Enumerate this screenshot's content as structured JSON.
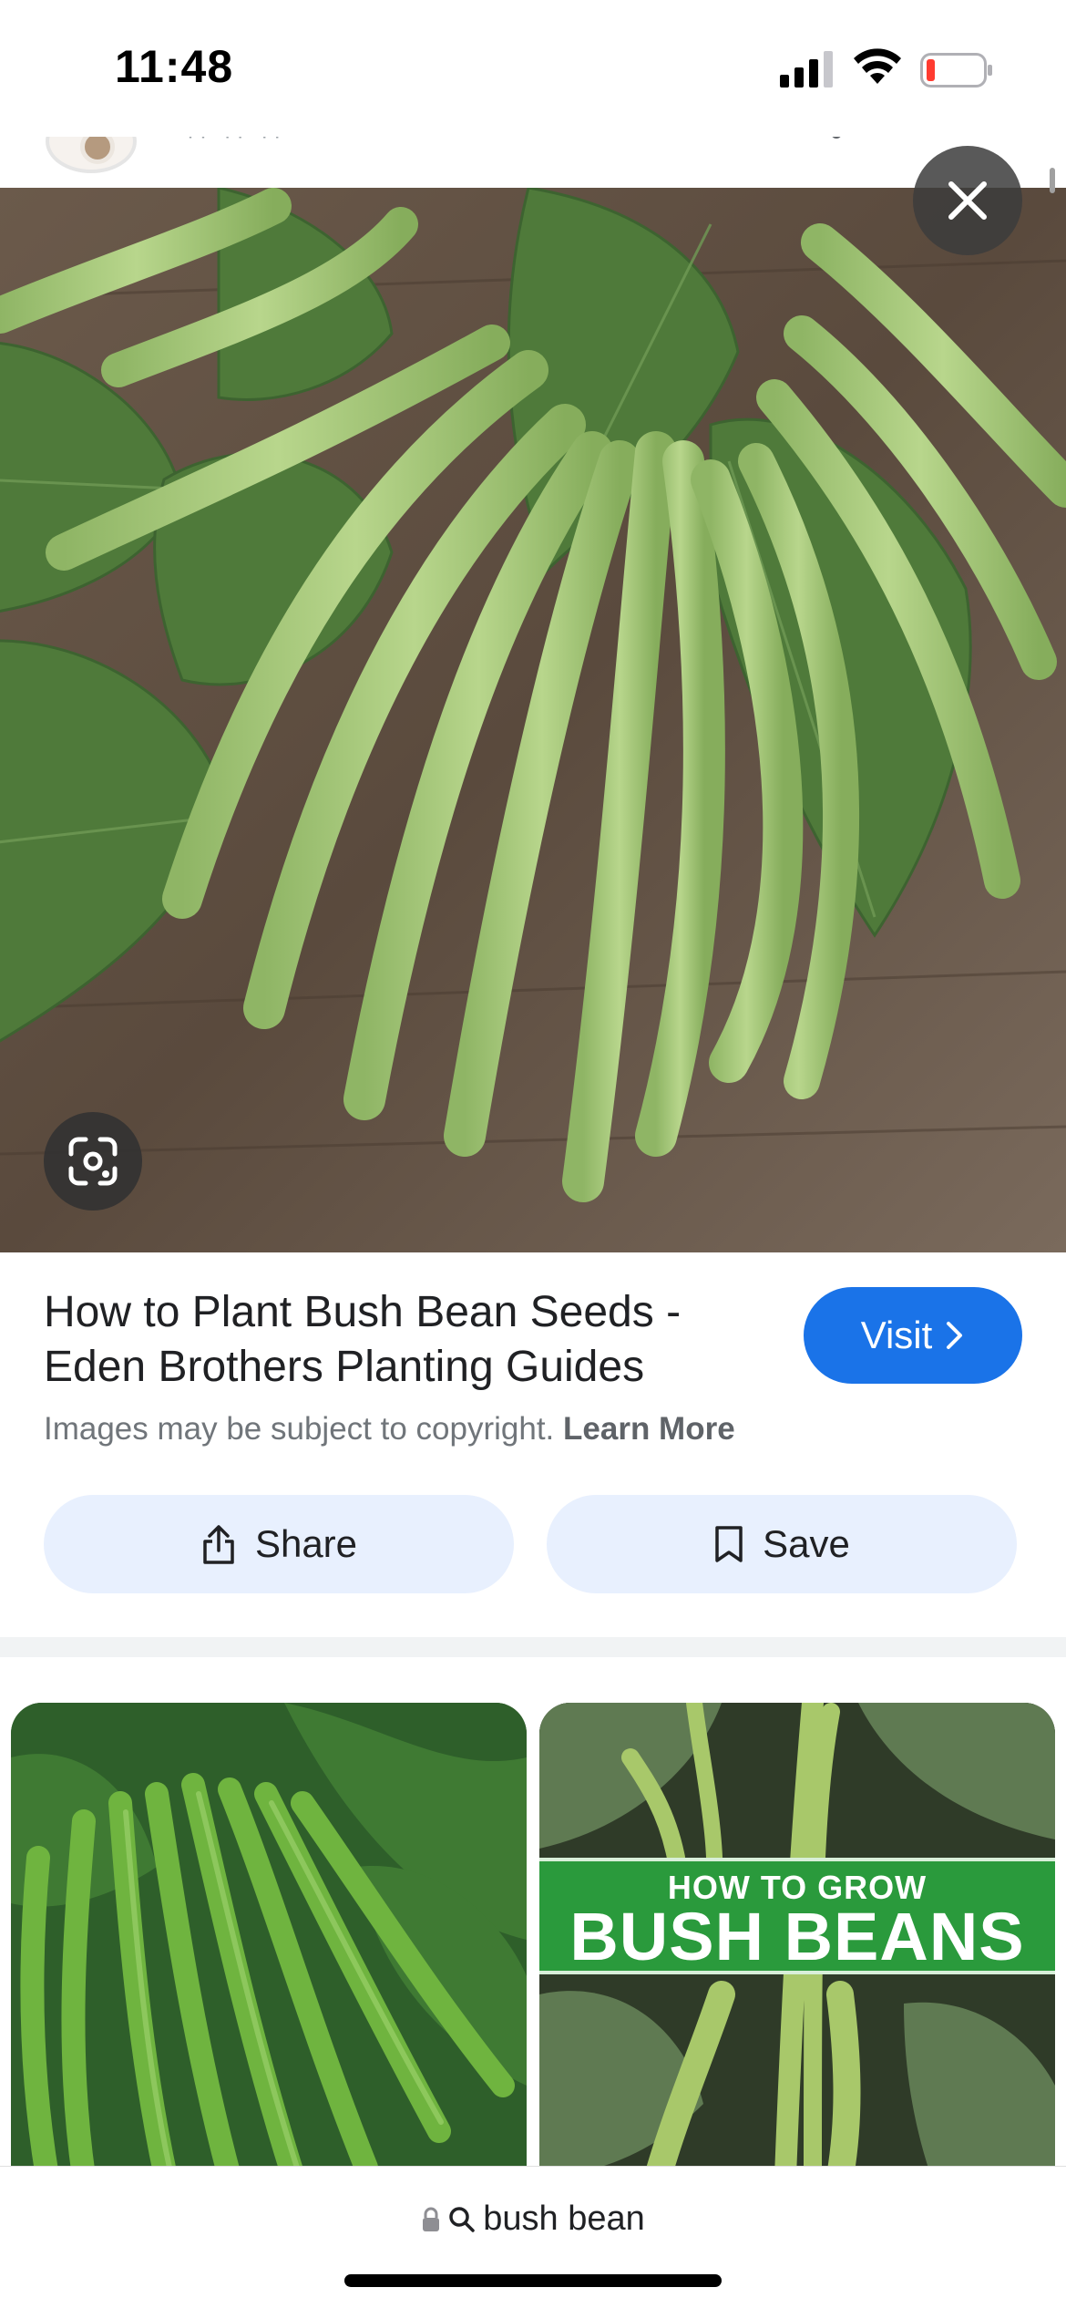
{
  "status_bar": {
    "time": "11:48",
    "icons": [
      "signal-icon",
      "wifi-icon",
      "battery-low-icon"
    ],
    "battery_color": "#ff3b30"
  },
  "header": {
    "favicon": "site-favicon"
  },
  "hero": {
    "subject": "green bush beans on wooden table",
    "close_icon": "close-icon",
    "lens_icon": "google-lens-icon"
  },
  "result": {
    "title_line1": "How to Plant Bush Bean Seeds -",
    "title_line2": "Eden Brothers Planting Guides",
    "visit_label": "Visit",
    "visit_icon": "chevron-right-icon",
    "copyright_text": "Images may be subject to copyright.",
    "learn_more": "Learn More",
    "share_label": "Share",
    "share_icon": "share-icon",
    "save_label": "Save",
    "save_icon": "bookmark-icon"
  },
  "related": [
    {
      "subject": "green beans on plant"
    },
    {
      "banner_top": "HOW TO GROW",
      "banner_main": "BUSH BEANS"
    }
  ],
  "bottom_bar": {
    "lock_icon": "lock-icon",
    "search_icon": "search-icon",
    "query": "bush bean"
  },
  "colors": {
    "accent": "#1a73e8",
    "tonal_button": "#e8f0fe",
    "divider": "#f1f3f4"
  }
}
